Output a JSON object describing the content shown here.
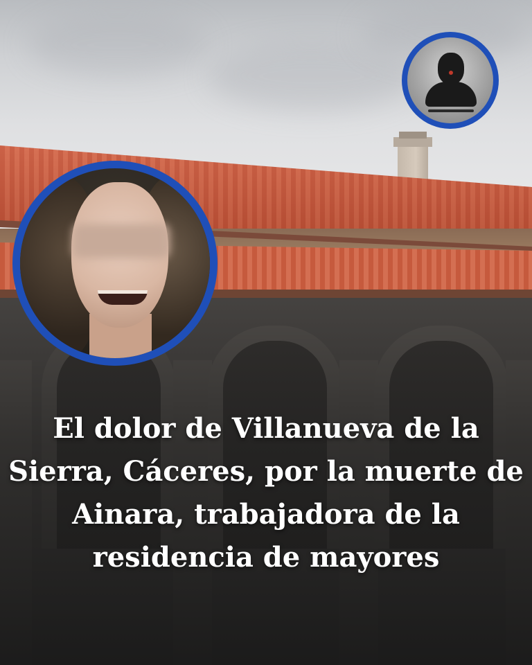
{
  "headline": {
    "line1": "El dolor de Villanueva de la",
    "line2": "Sierra, Cáceres, por la muerte de",
    "line3": "Ainara, trabajadora de la",
    "line4": "residencia de mayores"
  },
  "colors": {
    "accent_ring": "#1f4fb8",
    "headline_text": "#ffffff"
  },
  "icons": {
    "anonymous_profile": "silhouette-icon"
  }
}
